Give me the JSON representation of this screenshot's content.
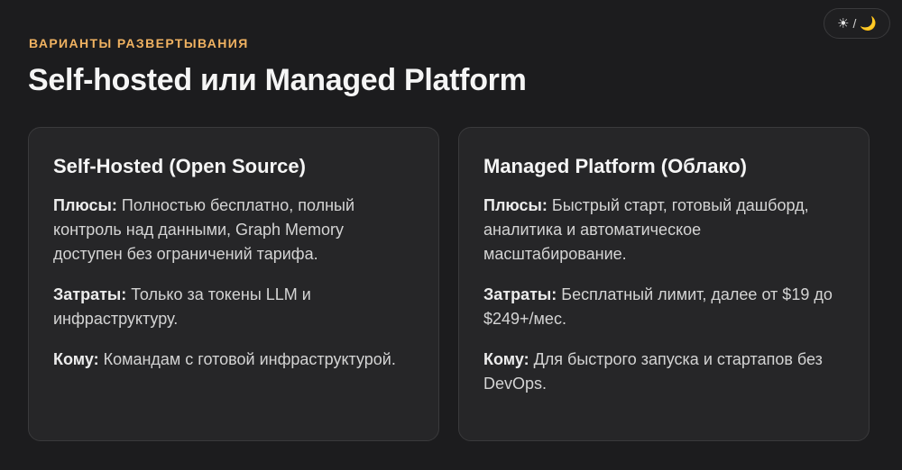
{
  "theme_toggle": {
    "sun": "☀",
    "separator": "/",
    "moon": "🌙"
  },
  "header": {
    "eyebrow": "ВАРИАНТЫ РАЗВЕРТЫВАНИЯ",
    "title": "Self-hosted или Managed Platform"
  },
  "cards": [
    {
      "title": "Self-Hosted (Open Source)",
      "items": [
        {
          "label": "Плюсы:",
          "text": " Полностью бесплатно, полный контроль над данными, Graph Memory доступен без ограничений тарифа."
        },
        {
          "label": "Затраты:",
          "text": " Только за токены LLM и инфраструктуру."
        },
        {
          "label": "Кому:",
          "text": " Командам с готовой инфраструктурой."
        }
      ]
    },
    {
      "title": "Managed Platform (Облако)",
      "items": [
        {
          "label": "Плюсы:",
          "text": " Быстрый старт, готовый дашборд, аналитика и автоматическое масштабирование."
        },
        {
          "label": "Затраты:",
          "text": " Бесплатный лимит, далее от $19 до $249+/мес."
        },
        {
          "label": "Кому:",
          "text": " Для быстрого запуска и стартапов без DevOps."
        }
      ]
    }
  ],
  "colors": {
    "background": "#1c1c1e",
    "card": "#262628",
    "accent": "#f0b261"
  }
}
